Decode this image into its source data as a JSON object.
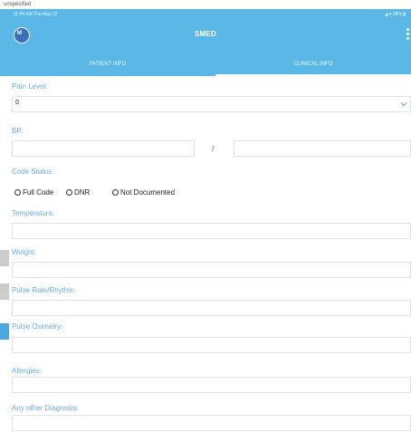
{
  "caption_above": "unspecified",
  "status_bar": {
    "time_date": "11:04 AM   Thu May 22",
    "indicators": "◢ ▾ 28% ▮"
  },
  "app_bar": {
    "logo_text": "M",
    "title": "SMED"
  },
  "tabs": [
    {
      "label": "PATIENT INFO",
      "active": false
    },
    {
      "label": "CLINICAL INFO",
      "active": true
    }
  ],
  "form": {
    "pain_level": {
      "label": "Pain Level:",
      "value": "0"
    },
    "bp": {
      "label": "BP:",
      "separator": "/"
    },
    "code_status": {
      "label": "Code Status:",
      "options": [
        "Full Code",
        "DNR",
        "Not Documented"
      ]
    },
    "temperature": {
      "label": "Temperature:"
    },
    "weight": {
      "label": "Weight:"
    },
    "pulse_rate": {
      "label": "Pulse Rate/Rhythm:"
    },
    "pulse_oximetry": {
      "label": "Pulse Oximetry:"
    },
    "allergies": {
      "label": "Allergies:"
    },
    "other_diagnosis": {
      "label": "Any other Diagnosis:"
    }
  },
  "colors": {
    "header": "#5bb8e6",
    "label": "#6aaee0",
    "logo": "#3a6fb7",
    "edge_tab_gray": "#cccccc",
    "edge_tab_blue": "#4aa9de"
  },
  "icons": {
    "dropdown": "chevron-down-icon",
    "overflow_menu": "more-vertical-icon"
  }
}
